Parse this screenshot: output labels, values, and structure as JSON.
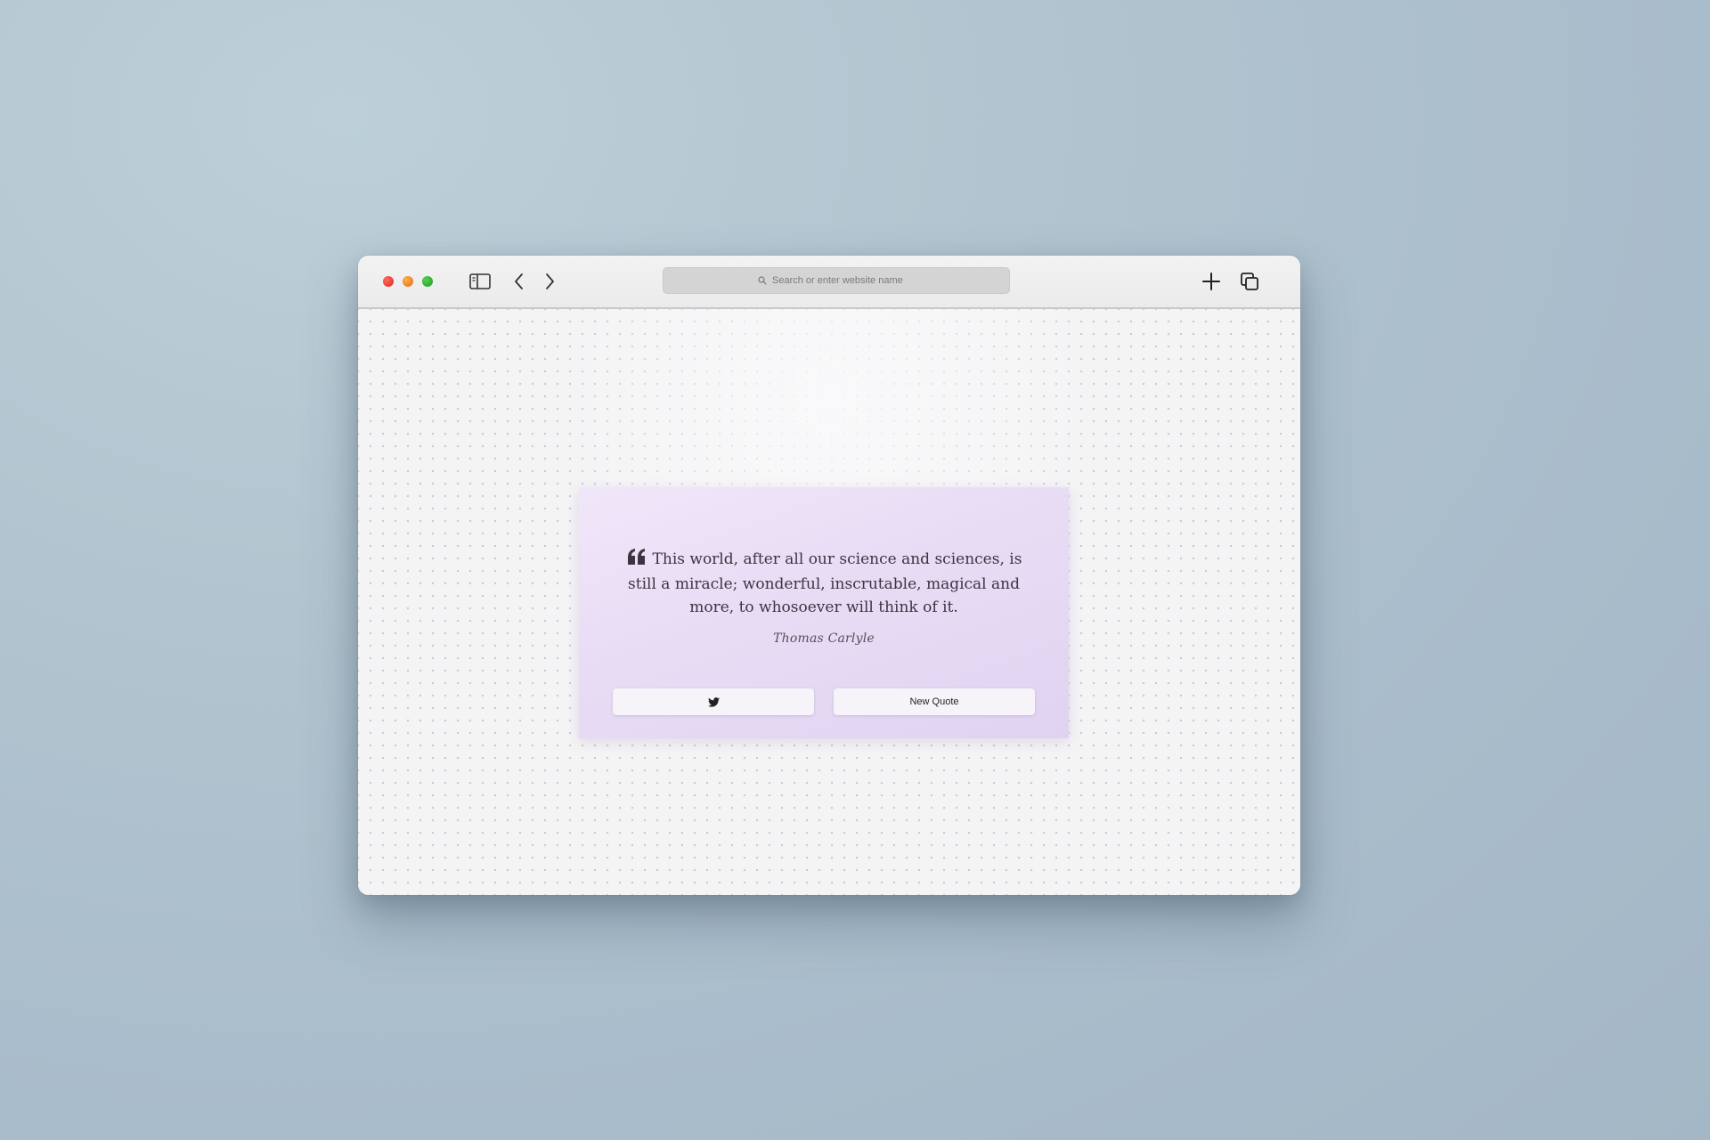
{
  "browser": {
    "address_bar": {
      "placeholder": "Search or enter website name",
      "icon": "search-icon"
    },
    "toolbar_icons": [
      "sidebar-toggle-icon",
      "chevron-left-icon",
      "chevron-right-icon",
      "plus-icon",
      "tabs-icon"
    ],
    "traffic_lights": {
      "close": "#e23b2e",
      "minimize": "#f08a22",
      "zoom": "#2db536"
    }
  },
  "quote_card": {
    "text": "This world, after all our science and sciences, is still a miracle; wonderful, inscrutable, magical and more, to whosoever will think of it.",
    "author": "Thomas Carlyle",
    "quote_icon": "quote-open-icon",
    "tweet_button_icon": "twitter-icon",
    "new_quote_label": "New Quote",
    "accent_color": "#e6d9f4"
  }
}
